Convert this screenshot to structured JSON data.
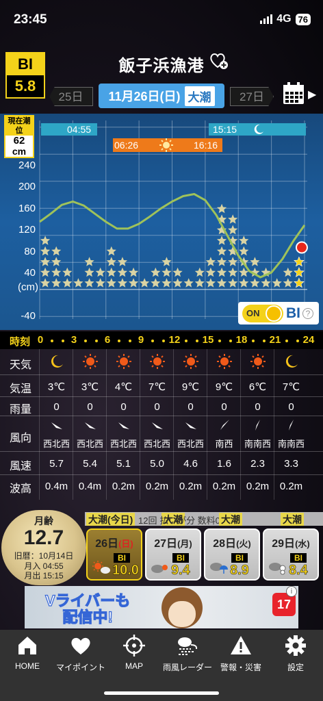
{
  "status_bar": {
    "time": "23:45",
    "network": "4G",
    "battery": "76"
  },
  "header": {
    "bi_label": "BI",
    "bi_value": "5.8",
    "port_name": "飯子浜漁港",
    "favorite_icon": "heart-plus-icon",
    "prev_date": "25日",
    "current_date": "11月26日(日)",
    "tide_type": "大潮",
    "next_date": "27日",
    "calendar_icon": "calendar-icon"
  },
  "chart": {
    "current_tide_label": "現在潮位",
    "current_tide_value": "62",
    "current_tide_unit": "cm",
    "moonrise_time": "04:55",
    "moonset_time": "15:15",
    "sunrise_time": "06:26",
    "sunset_time": "16:16",
    "y_labels": [
      "240",
      "200",
      "160",
      "120",
      "80",
      "40",
      "(cm)",
      "-40"
    ],
    "toggle_on_label": "ON",
    "toggle_bi_label": "BI",
    "toggle_help": "?"
  },
  "chart_data": {
    "type": "line",
    "xlabel": "時刻",
    "ylabel": "(cm)",
    "ylim": [
      -60,
      260
    ],
    "x_ticks": [
      "0",
      "3",
      "6",
      "9",
      "12",
      "15",
      "18",
      "21",
      "24"
    ],
    "tide_curve": {
      "x": [
        0,
        1,
        2,
        3,
        4,
        5,
        6,
        7,
        8,
        9,
        10,
        11,
        12,
        13,
        14,
        15,
        16,
        17,
        18,
        19,
        20,
        21,
        22,
        23,
        24
      ],
      "y": [
        100,
        112,
        125,
        130,
        124,
        112,
        100,
        90,
        90,
        97,
        108,
        120,
        130,
        138,
        141,
        132,
        110,
        80,
        50,
        27,
        18,
        25,
        45,
        72,
        95
      ]
    },
    "bi_star_columns": {
      "x": [
        0,
        1,
        2,
        3,
        4,
        5,
        6,
        7,
        8,
        9,
        10,
        11,
        12,
        13,
        14,
        15,
        16,
        17,
        18,
        19,
        20,
        21,
        22,
        23
      ],
      "stars": [
        5,
        4,
        2,
        1,
        3,
        2,
        4,
        3,
        2,
        1,
        2,
        3,
        2,
        1,
        2,
        3,
        8,
        7,
        5,
        3,
        2,
        1,
        2,
        3
      ]
    }
  },
  "hours": {
    "label": "時刻",
    "ticks": [
      "0",
      "3",
      "6",
      "9",
      "12",
      "15",
      "18",
      "21",
      "24"
    ]
  },
  "forecast": {
    "weather_label": "天気",
    "weather_icons": [
      "moon-icon",
      "sun-icon",
      "sun-icon",
      "sun-icon",
      "sun-icon",
      "sun-icon",
      "sun-icon",
      "moon-icon"
    ],
    "temp_label": "気温",
    "temps": [
      "3℃",
      "3℃",
      "4℃",
      "7℃",
      "9℃",
      "9℃",
      "6℃",
      "7℃"
    ],
    "rain_label": "雨量",
    "rain": [
      "0",
      "0",
      "0",
      "0",
      "0",
      "0",
      "0",
      "0"
    ],
    "wind_dir_label": "風向",
    "wind_dirs": [
      "西北西",
      "西北西",
      "西北西",
      "西北西",
      "西北西",
      "南西",
      "南南西",
      "南南西"
    ],
    "wind_speed_label": "風速",
    "wind_speeds": [
      "5.7",
      "5.4",
      "5.1",
      "5.0",
      "4.6",
      "1.6",
      "2.3",
      "3.3"
    ],
    "wave_label": "波高",
    "waves": [
      "0.4m",
      "0.4m",
      "0.2m",
      "0.2m",
      "0.2m",
      "0.2m",
      "0.2m",
      "0.2m"
    ]
  },
  "moon_info": {
    "age_label": "月齢",
    "age_value": "12.7",
    "lunar_date": "旧暦：10月14日",
    "moonrise": "月入 04:55",
    "moonset": "月出 15:15"
  },
  "ticker": {
    "tag1": "大潮",
    "tag1_suffix": "(今日)",
    "tag2": "大潮",
    "tag3": "大潮",
    "tag4": "大潮",
    "text": "12回 払いが分 数料0"
  },
  "days": [
    {
      "day": "26日",
      "dow": "(日)",
      "bi_label": "BI",
      "bi": "10.0",
      "weather": "sun-cloud-icon"
    },
    {
      "day": "27日",
      "dow": "(月)",
      "bi_label": "BI",
      "bi": "9.4",
      "weather": "cloud-sun-icon"
    },
    {
      "day": "28日",
      "dow": "(火)",
      "bi_label": "BI",
      "bi": "8.9",
      "weather": "cloud-umbrella-icon"
    },
    {
      "day": "29日",
      "dow": "(水)",
      "bi_label": "BI",
      "bi": "8.4",
      "weather": "cloud-snow-icon"
    }
  ],
  "ad": {
    "text_line1": "Vライバーも",
    "text_line2": "配信中!",
    "app_label": "17",
    "info": "i"
  },
  "tabs": [
    {
      "label": "HOME",
      "icon": "home-icon"
    },
    {
      "label": "マイポイント",
      "icon": "heart-icon"
    },
    {
      "label": "MAP",
      "icon": "crosshair-icon"
    },
    {
      "label": "雨風レーダー",
      "icon": "cloud-wind-icon"
    },
    {
      "label": "警報・災害",
      "icon": "warning-icon"
    },
    {
      "label": "設定",
      "icon": "gear-icon"
    }
  ],
  "colors": {
    "accent_yellow": "#f4d21a",
    "chart_blue": "#1d5fa0",
    "date_blue": "#49a3e6",
    "sun_orange": "#ee7a1a",
    "moon_cyan": "#2ea6c6",
    "tide_line": "#9fc25a"
  }
}
